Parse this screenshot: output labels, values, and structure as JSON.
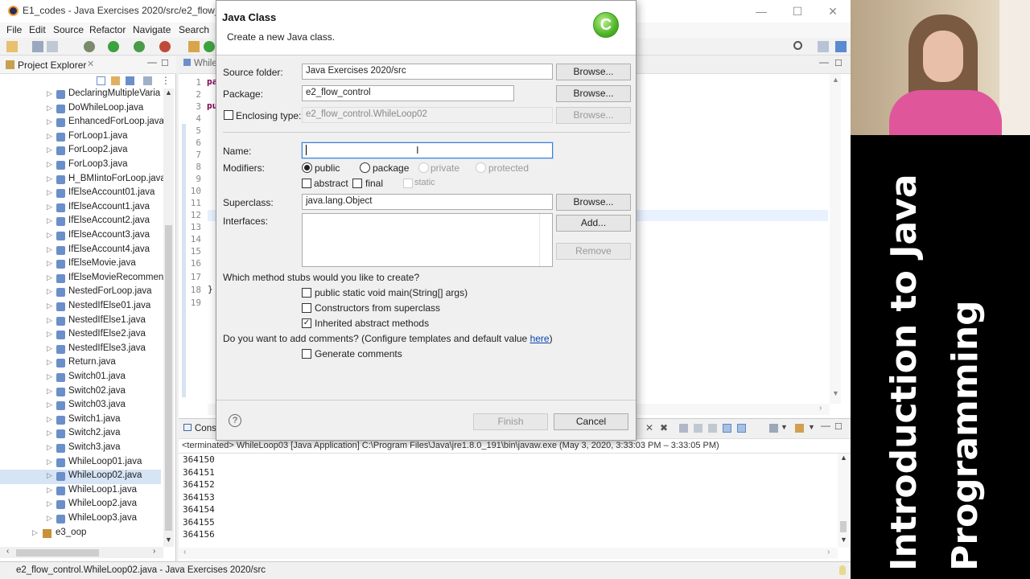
{
  "window": {
    "title": "E1_codes - Java Exercises 2020/src/e2_flow_con"
  },
  "menu": [
    "File",
    "Edit",
    "Source",
    "Refactor",
    "Navigate",
    "Search"
  ],
  "explorer": {
    "title": "Project Explorer",
    "items": [
      "DeclaringMultipleVaria",
      "DoWhileLoop.java",
      "EnhancedForLoop.java",
      "ForLoop1.java",
      "ForLoop2.java",
      "ForLoop3.java",
      "H_BMIintoForLoop.java",
      "IfElseAccount01.java",
      "IfElseAccount1.java",
      "IfElseAccount2.java",
      "IfElseAccount3.java",
      "IfElseAccount4.java",
      "IfElseMovie.java",
      "IfElseMovieRecommen",
      "NestedForLoop.java",
      "NestedIfElse01.java",
      "NestedIfElse1.java",
      "NestedIfElse2.java",
      "NestedIfElse3.java",
      "Return.java",
      "Switch01.java",
      "Switch02.java",
      "Switch03.java",
      "Switch1.java",
      "Switch2.java",
      "Switch3.java",
      "WhileLoop01.java",
      "WhileLoop02.java",
      "WhileLoop1.java",
      "WhileLoop2.java",
      "WhileLoop3.java"
    ],
    "selected_index": 27,
    "package_item": "e3_oop"
  },
  "editor": {
    "tab": "While",
    "line_numbers": [
      "1",
      "2",
      "3",
      "4",
      "5",
      "6",
      "7",
      "8",
      "9",
      "10",
      "11",
      "12",
      "13",
      "14",
      "15",
      "16",
      "17",
      "18",
      "19"
    ],
    "code_fragments": {
      "l1": "pa",
      "l3": "pu",
      "l18": "}"
    }
  },
  "console": {
    "tab": "Cons",
    "status": "<terminated> WhileLoop03 [Java Application] C:\\Program Files\\Java\\jre1.8.0_191\\bin\\javaw.exe  (May 3, 2020, 3:33:03 PM – 3:33:05 PM)",
    "lines": [
      "364150",
      "364151",
      "364152",
      "364153",
      "364154",
      "364155",
      "364156"
    ]
  },
  "statusbar": {
    "text": "e2_flow_control.WhileLoop02.java - Java Exercises 2020/src"
  },
  "dialog": {
    "title": "Java Class",
    "subtitle": "Create a new Java class.",
    "logo_letter": "C",
    "source_folder_label": "Source folder:",
    "source_folder_value": "Java Exercises 2020/src",
    "package_label": "Package:",
    "package_value": "e2_flow_control",
    "enclosing_label": "Enclosing type:",
    "enclosing_value": "e2_flow_control.WhileLoop02",
    "browse_label": "Browse...",
    "name_label": "Name:",
    "name_value": "",
    "modifiers_label": "Modifiers:",
    "mod_public": "public",
    "mod_package": "package",
    "mod_private": "private",
    "mod_protected": "protected",
    "mod_abstract": "abstract",
    "mod_final": "final",
    "mod_static": "static",
    "superclass_label": "Superclass:",
    "superclass_value": "java.lang.Object",
    "interfaces_label": "Interfaces:",
    "add_label": "Add...",
    "remove_label": "Remove",
    "stubs_question": "Which method stubs would you like to create?",
    "stub_main": "public static void main(String[] args)",
    "stub_constructors": "Constructors from superclass",
    "stub_inherited": "Inherited abstract methods",
    "comments_question": "Do you want to add comments? (Configure templates and default value ",
    "comments_link": "here",
    "comments_close": ")",
    "generate_comments": "Generate comments",
    "help_icon": "?",
    "finish_label": "Finish",
    "cancel_label": "Cancel"
  },
  "banner": {
    "text": "Introduction to Java Programming",
    "background": "#000000",
    "color": "#ffffff"
  },
  "colors": {
    "focus_border": "#3c7fd6",
    "link": "#0645ad",
    "selection": "#d6e4f5"
  }
}
